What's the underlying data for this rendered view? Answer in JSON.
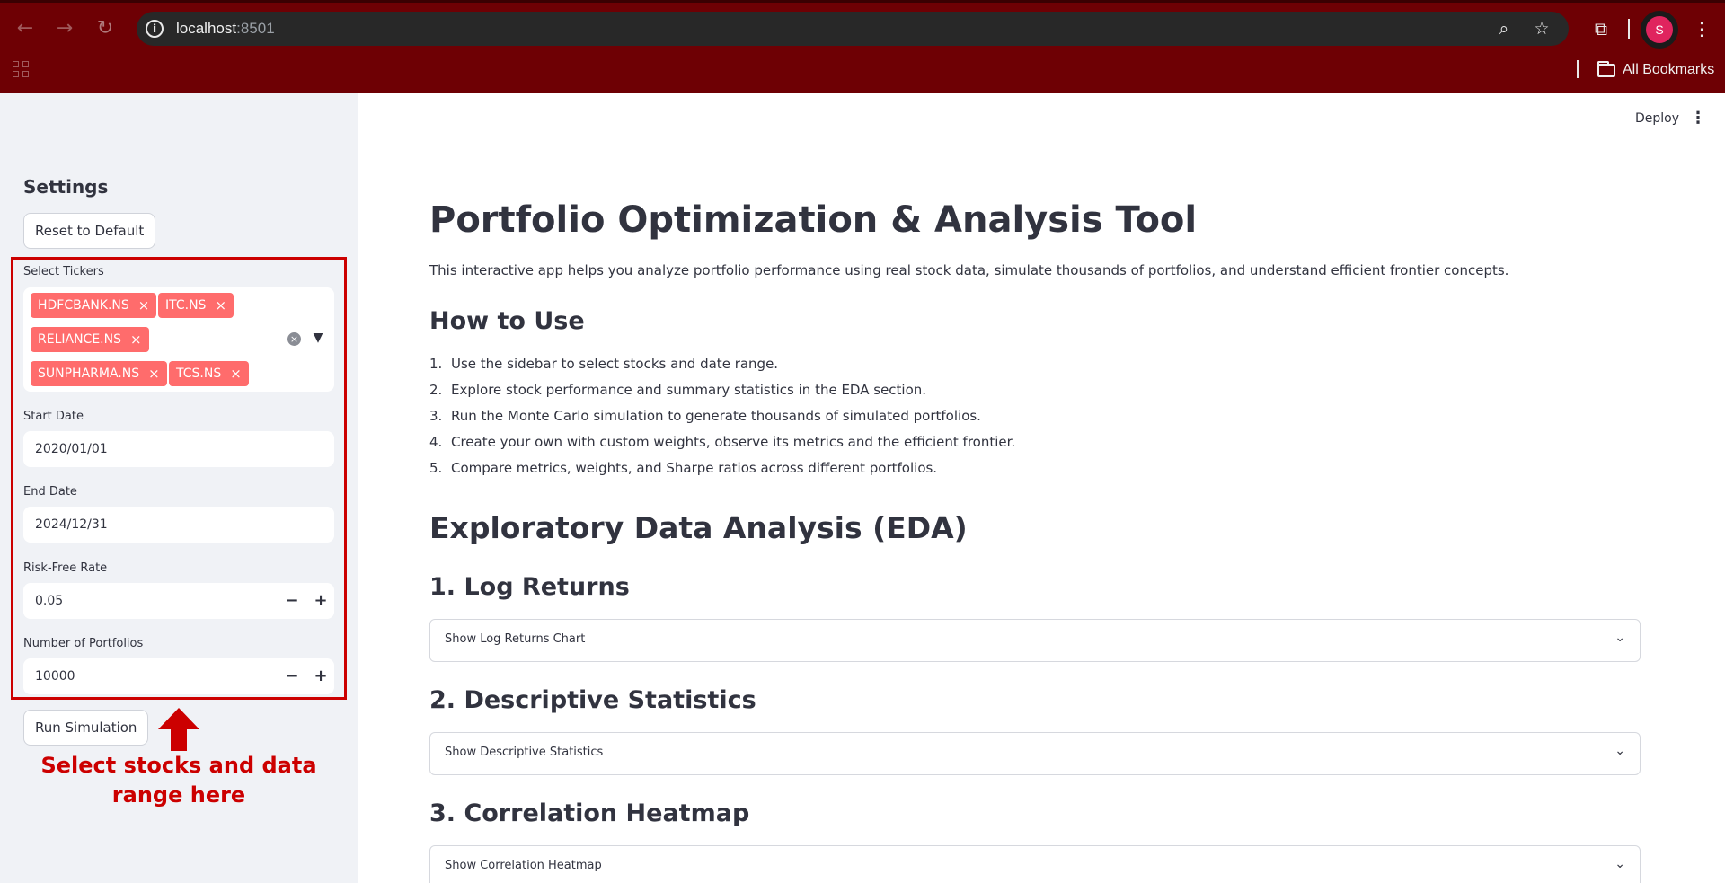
{
  "browser": {
    "url_host": "localhost",
    "url_port": ":8501",
    "bookmarks_label": "All Bookmarks",
    "avatar_initial": "S"
  },
  "header": {
    "deploy_label": "Deploy"
  },
  "sidebar": {
    "title": "Settings",
    "reset_label": "Reset to Default",
    "tickers_label": "Select Tickers",
    "tickers": [
      "HDFCBANK.NS",
      "ITC.NS",
      "RELIANCE.NS",
      "SUNPHARMA.NS",
      "TCS.NS"
    ],
    "start_date_label": "Start Date",
    "start_date": "2020/01/01",
    "end_date_label": "End Date",
    "end_date": "2024/12/31",
    "risk_free_label": "Risk-Free Rate",
    "risk_free_value": "0.05",
    "num_portfolios_label": "Number of Portfolios",
    "num_portfolios_value": "10000",
    "run_label": "Run Simulation",
    "annotation": "Select stocks and data range here"
  },
  "main": {
    "title": "Portfolio Optimization & Analysis Tool",
    "intro": "This interactive app helps you analyze portfolio performance using real stock data, simulate thousands of portfolios, and understand efficient frontier concepts.",
    "how_to_use": "How to Use",
    "steps": [
      "Use the sidebar to select stocks and date range.",
      "Explore stock performance and summary statistics in the EDA section.",
      "Run the Monte Carlo simulation to generate thousands of simulated portfolios.",
      "Create your own with custom weights, observe its metrics and the efficient frontier.",
      "Compare metrics, weights, and Sharpe ratios across different portfolios."
    ],
    "eda_title": "Exploratory Data Analysis (EDA)",
    "sections": [
      {
        "heading": "1. Log Returns",
        "expander": "Show Log Returns Chart"
      },
      {
        "heading": "2. Descriptive Statistics",
        "expander": "Show Descriptive Statistics"
      },
      {
        "heading": "3. Correlation Heatmap",
        "expander": "Show Correlation Heatmap"
      }
    ]
  }
}
